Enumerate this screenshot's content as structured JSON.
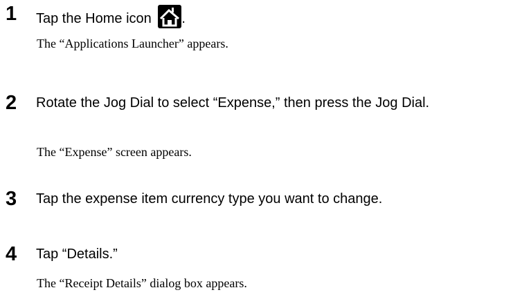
{
  "steps": [
    {
      "number": "1",
      "instruction_before_icon": "Tap the Home icon",
      "icon": "home-icon",
      "instruction_after_icon": ".",
      "result": "The “Applications Launcher” appears."
    },
    {
      "number": "2",
      "instruction": "Rotate the Jog Dial to select “Expense,” then press the Jog Dial.",
      "result": "The “Expense” screen appears."
    },
    {
      "number": "3",
      "instruction": "Tap the expense item currency type you want to change."
    },
    {
      "number": "4",
      "instruction": "Tap “Details.”",
      "result": "The “Receipt Details” dialog box appears."
    }
  ]
}
